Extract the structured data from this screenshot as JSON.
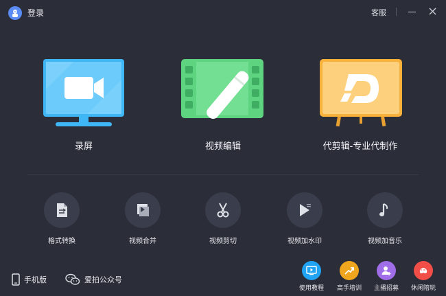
{
  "titlebar": {
    "login_label": "登录",
    "support_label": "客服"
  },
  "features": [
    {
      "label": "录屏",
      "icon": "screen-record-icon"
    },
    {
      "label": "视频编辑",
      "icon": "video-edit-icon"
    },
    {
      "label": "代剪辑-专业代制作",
      "icon": "easel-logo-icon"
    }
  ],
  "tools": [
    {
      "label": "格式转换",
      "icon": "document-convert-icon"
    },
    {
      "label": "视频合并",
      "icon": "video-merge-icon"
    },
    {
      "label": "视频剪切",
      "icon": "scissors-icon"
    },
    {
      "label": "视频加水印",
      "icon": "play-watermark-icon"
    },
    {
      "label": "视频加音乐",
      "icon": "music-note-icon"
    }
  ],
  "bottom_left": [
    {
      "label": "手机版",
      "icon": "phone-icon"
    },
    {
      "label": "爱拍公众号",
      "icon": "wechat-icon"
    }
  ],
  "bottom_right": [
    {
      "label": "使用教程",
      "icon": "play-screen-icon",
      "color": "#1fa3f2"
    },
    {
      "label": "高手培训",
      "icon": "trend-up-icon",
      "color": "#f0a51e"
    },
    {
      "label": "主播招募",
      "icon": "person-add-icon",
      "color": "#a06de8"
    },
    {
      "label": "休闲陪玩",
      "icon": "game-icon",
      "color": "#f04e46"
    }
  ],
  "colors": {
    "background": "#2b2d38",
    "record_blue": "#3fb7f7",
    "edit_green": "#5ed480",
    "easel_orange": "#fbb23c"
  }
}
